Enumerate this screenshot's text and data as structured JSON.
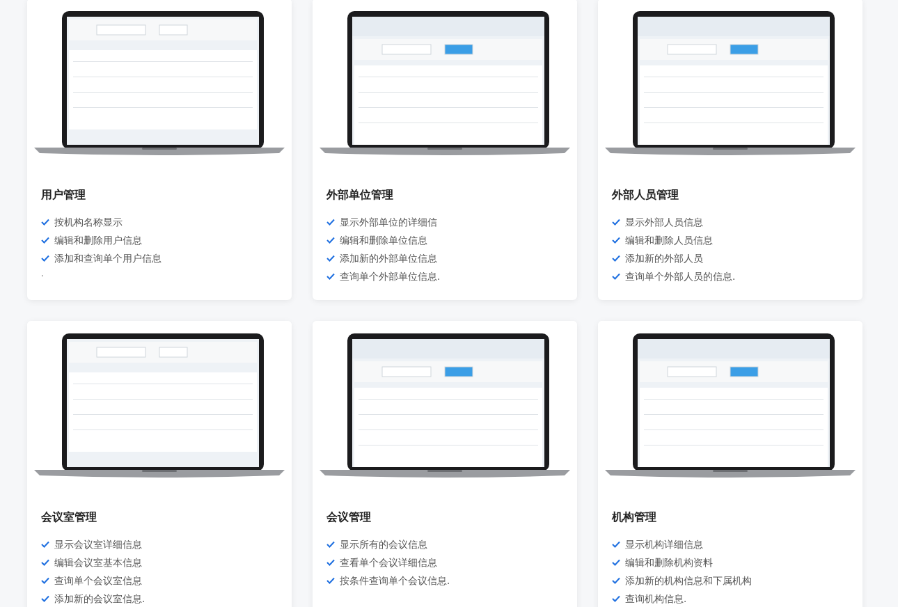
{
  "cards": [
    {
      "image": {
        "kind": "picture"
      },
      "title": "用户管理",
      "features": [
        "按机构名称显示",
        "编辑和删除用户信息",
        "添加和查询单个用户信息"
      ],
      "note": "."
    },
    {
      "image": {
        "kind": "picture"
      },
      "title": "外部单位管理",
      "features": [
        "显示外部单位的详细信",
        "编辑和删除单位信息",
        "添加新的外部单位信息",
        "查询单个外部单位信息."
      ]
    },
    {
      "image": {
        "kind": "picture"
      },
      "title": "外部人员管理",
      "features": [
        "显示外部人员信息",
        "编辑和删除人员信息",
        "添加新的外部人员",
        "查询单个外部人员的信息."
      ]
    },
    {
      "image": {
        "kind": "picture"
      },
      "title": "会议室管理",
      "features": [
        "显示会议室详细信息",
        "编辑会议室基本信息",
        "查询单个会议室信息",
        "添加新的会议室信息."
      ]
    },
    {
      "image": {
        "kind": "picture"
      },
      "title": "会议管理",
      "features": [
        "显示所有的会议信息",
        "查看单个会议详细信息",
        "按条件查询单个会议信息."
      ]
    },
    {
      "image": {
        "kind": "picture"
      },
      "title": "机构管理",
      "features": [
        "显示机构详细信息",
        "编辑和删除机构资料",
        "添加新的机构信息和下属机构",
        "查询机构信息."
      ]
    }
  ]
}
